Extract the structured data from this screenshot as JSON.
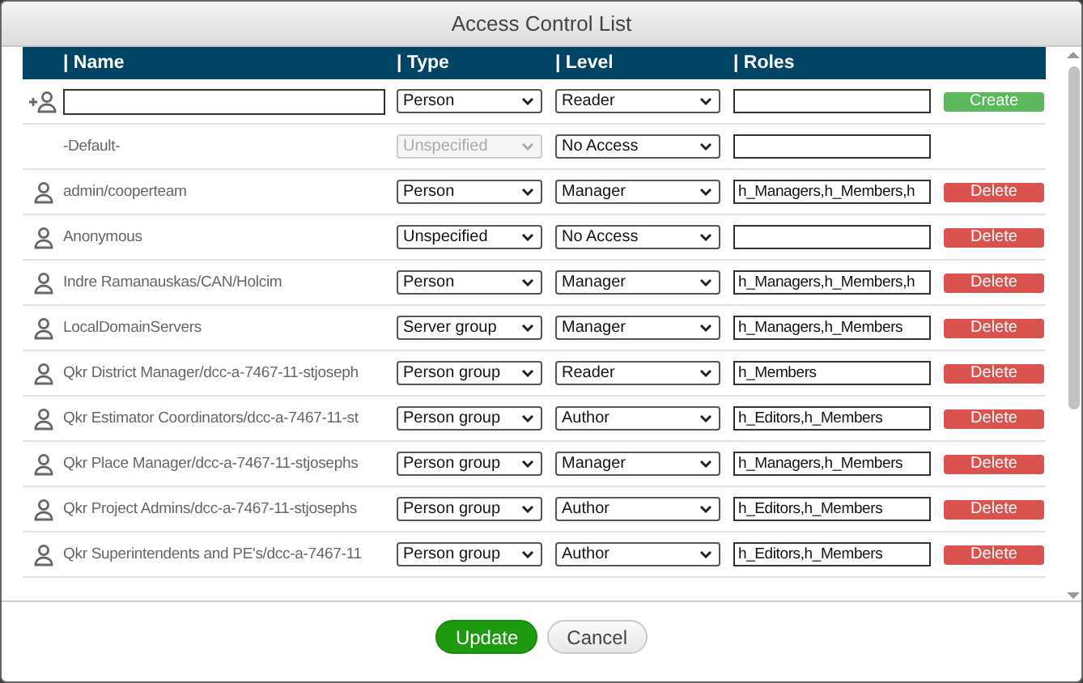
{
  "window": {
    "title": "Access Control List"
  },
  "table": {
    "columns": [
      "| Name",
      "| Type",
      "| Level",
      "| Roles"
    ],
    "rows": [
      {
        "kind": "new",
        "name": "",
        "type": "Person",
        "type_disabled": false,
        "level": "Reader",
        "roles": "",
        "action": "Create"
      },
      {
        "kind": "default",
        "name": "-Default-",
        "type": "Unspecified",
        "type_disabled": true,
        "level": "No Access",
        "roles": ""
      },
      {
        "kind": "member",
        "name": "admin/cooperteam",
        "type": "Person",
        "type_disabled": false,
        "level": "Manager",
        "roles": "h_Managers,h_Members,h",
        "action": "Delete"
      },
      {
        "kind": "member",
        "name": "Anonymous",
        "type": "Unspecified",
        "type_disabled": false,
        "level": "No Access",
        "roles": "",
        "action": "Delete"
      },
      {
        "kind": "member",
        "name": "Indre Ramanauskas/CAN/Holcim",
        "type": "Person",
        "type_disabled": false,
        "level": "Manager",
        "roles": "h_Managers,h_Members,h",
        "action": "Delete"
      },
      {
        "kind": "member",
        "name": "LocalDomainServers",
        "type": "Server group",
        "type_disabled": false,
        "level": "Manager",
        "roles": "h_Managers,h_Members",
        "action": "Delete"
      },
      {
        "kind": "member",
        "name": "Qkr District Manager/dcc-a-7467-11-stjoseph",
        "type": "Person group",
        "type_disabled": false,
        "level": "Reader",
        "roles": "h_Members",
        "action": "Delete"
      },
      {
        "kind": "member",
        "name": "Qkr Estimator Coordinators/dcc-a-7467-11-st",
        "type": "Person group",
        "type_disabled": false,
        "level": "Author",
        "roles": "h_Editors,h_Members",
        "action": "Delete"
      },
      {
        "kind": "member",
        "name": "Qkr Place Manager/dcc-a-7467-11-stjosephs",
        "type": "Person group",
        "type_disabled": false,
        "level": "Manager",
        "roles": "h_Managers,h_Members",
        "action": "Delete"
      },
      {
        "kind": "member",
        "name": "Qkr Project Admins/dcc-a-7467-11-stjosephs",
        "type": "Person group",
        "type_disabled": false,
        "level": "Author",
        "roles": "h_Editors,h_Members",
        "action": "Delete"
      },
      {
        "kind": "member",
        "name": "Qkr Superintendents and PE's/dcc-a-7467-11",
        "type": "Person group",
        "type_disabled": false,
        "level": "Author",
        "roles": "h_Editors,h_Members",
        "action": "Delete"
      }
    ]
  },
  "buttons": [
    {
      "label": "Update",
      "kind": "primary"
    },
    {
      "label": "Cancel",
      "kind": "secondary"
    }
  ]
}
